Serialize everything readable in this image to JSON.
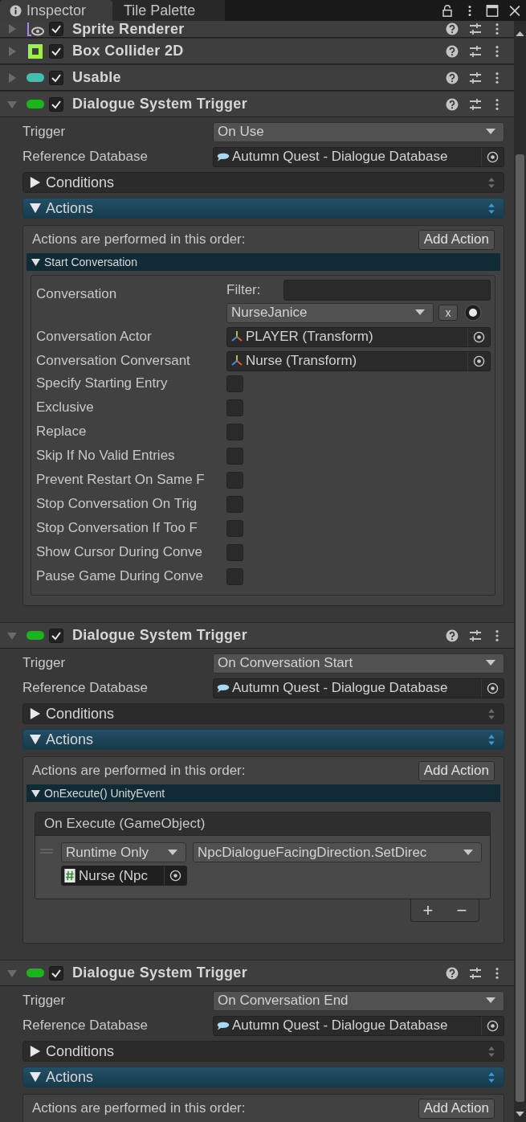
{
  "tabs": [
    {
      "label": "Inspector",
      "selected": true
    },
    {
      "label": "Tile Palette",
      "selected": false
    }
  ],
  "components": [
    {
      "kind": "sprite",
      "name": "Sprite Renderer",
      "expanded": false,
      "enabled": true
    },
    {
      "kind": "box_collider",
      "name": "Box Collider 2D",
      "expanded": false,
      "enabled": true
    },
    {
      "kind": "usable",
      "name": "Usable",
      "expanded": false,
      "enabled": true
    },
    {
      "kind": "trigger",
      "name": "Dialogue System Trigger",
      "expanded": true,
      "enabled": true,
      "fields": [
        {
          "kind": "popup",
          "label": "Trigger",
          "value": "On Use"
        },
        {
          "kind": "object",
          "label": "Reference Database",
          "value": "Autumn Quest - Dialogue Database"
        }
      ],
      "sections": [
        {
          "label": "Conditions",
          "expanded": false
        },
        {
          "label": "Actions",
          "expanded": true
        }
      ],
      "actions": {
        "note": "Actions are performed in this order:",
        "add_button": "Add Action",
        "items": [
          {
            "kind": "start_conversation",
            "title": "Start Conversation",
            "expanded": true,
            "rows": [
              {
                "kind": "conversation",
                "label": "Conversation",
                "filter_label": "Filter:",
                "value": "NurseJanice",
                "clear": "x"
              },
              {
                "kind": "object",
                "label": "Conversation Actor",
                "value": "PLAYER (Transform)"
              },
              {
                "kind": "object",
                "label": "Conversation Conversant",
                "value": "Nurse (Transform)"
              },
              {
                "kind": "checkbox",
                "label": "Specify Starting Entry",
                "checked": false
              },
              {
                "kind": "checkbox",
                "label": "Exclusive",
                "checked": false
              },
              {
                "kind": "checkbox",
                "label": "Replace",
                "checked": false
              },
              {
                "kind": "checkbox",
                "label": "Skip If No Valid Entries",
                "checked": false
              },
              {
                "kind": "checkbox",
                "label": "Prevent Restart On Same F",
                "checked": false
              },
              {
                "kind": "checkbox",
                "label": "Stop Conversation On Trig",
                "checked": false
              },
              {
                "kind": "checkbox",
                "label": "Stop Conversation If Too F",
                "checked": false
              },
              {
                "kind": "checkbox",
                "label": "Show Cursor During Conve",
                "checked": false
              },
              {
                "kind": "checkbox",
                "label": "Pause Game During Conve",
                "checked": false
              }
            ]
          }
        ]
      }
    },
    {
      "kind": "trigger",
      "name": "Dialogue System Trigger",
      "expanded": true,
      "enabled": true,
      "fields": [
        {
          "kind": "popup",
          "label": "Trigger",
          "value": "On Conversation Start"
        },
        {
          "kind": "object",
          "label": "Reference Database",
          "value": "Autumn Quest - Dialogue Database"
        }
      ],
      "sections": [
        {
          "label": "Conditions",
          "expanded": false
        },
        {
          "label": "Actions",
          "expanded": true
        }
      ],
      "actions": {
        "note": "Actions are performed in this order:",
        "add_button": "Add Action",
        "items": [
          {
            "kind": "unity_event",
            "title": "OnExecute() UnityEvent",
            "expanded": true,
            "event": {
              "title": "On Execute (GameObject)",
              "listeners": [
                {
                  "mode": "Runtime Only",
                  "method": "NpcDialogueFacingDirection.SetDirec",
                  "target": "Nurse (Npc"
                }
              ],
              "add": "+",
              "remove": "−"
            }
          }
        ]
      }
    },
    {
      "kind": "trigger",
      "name": "Dialogue System Trigger",
      "expanded": true,
      "enabled": true,
      "fields": [
        {
          "kind": "popup",
          "label": "Trigger",
          "value": "On Conversation End"
        },
        {
          "kind": "object",
          "label": "Reference Database",
          "value": "Autumn Quest - Dialogue Database"
        }
      ],
      "sections": [
        {
          "label": "Conditions",
          "expanded": false
        },
        {
          "label": "Actions",
          "expanded": true
        }
      ],
      "actions": {
        "note": "Actions are performed in this order:",
        "add_button": "Add Action"
      }
    }
  ]
}
